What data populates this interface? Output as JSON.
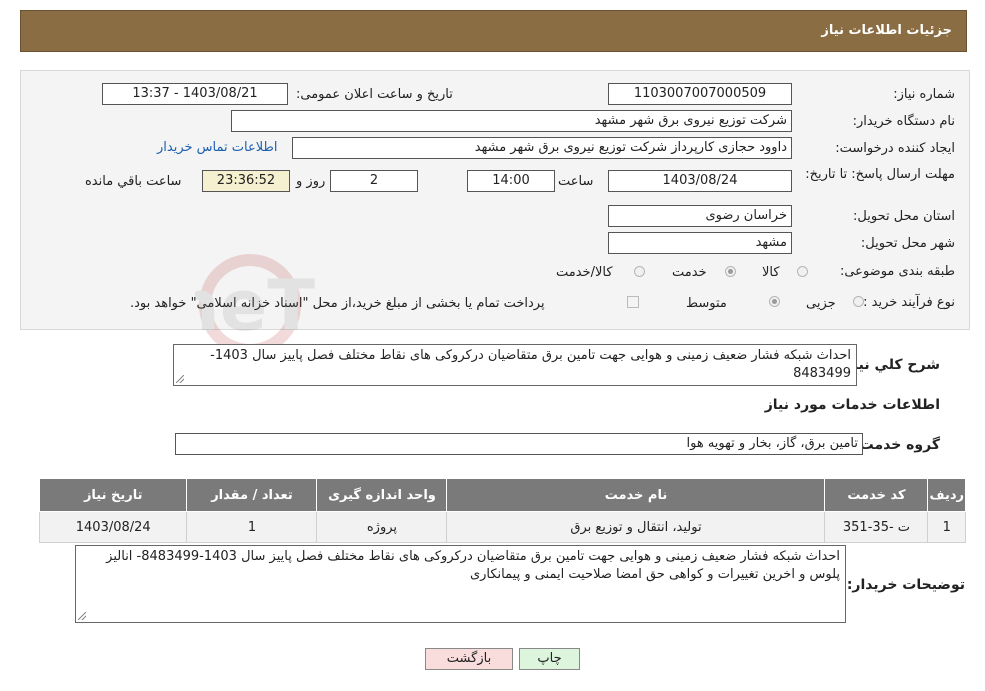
{
  "header": {
    "title": "جزئیات اطلاعات نیاز"
  },
  "form": {
    "need_number": {
      "label": "شماره نیاز:",
      "value": "1103007007000509"
    },
    "announce_datetime": {
      "label": "تاریخ و ساعت اعلان عمومی:",
      "value": "1403/08/21 - 13:37"
    },
    "buyer_org": {
      "label": "نام دستگاه خريدار:",
      "value": "شرکت توزیع نیروی برق شهر مشهد"
    },
    "requester": {
      "label": "ایجاد کننده درخواست:",
      "value": "داوود حجازی کارپرداز شرکت توزیع نیروی برق شهر مشهد",
      "contact_link": "اطلاعات تماس خریدار"
    },
    "deadline": {
      "label": "مهلت ارسال پاسخ: تا تاریخ:",
      "date": "1403/08/24",
      "time_label": "ساعت",
      "time": "14:00",
      "days": "2",
      "days_label": "روز و",
      "remaining": "23:36:52",
      "remaining_label": "ساعت باقي مانده"
    },
    "province": {
      "label": "استان محل تحویل:",
      "value": "خراسان رضوی"
    },
    "city": {
      "label": "شهر محل تحویل:",
      "value": "مشهد"
    },
    "category": {
      "label": "طبقه بندی موضوعی:",
      "options": [
        {
          "label": "کالا",
          "checked": false
        },
        {
          "label": "خدمت",
          "checked": true
        },
        {
          "label": "کالا/خدمت",
          "checked": false
        }
      ]
    },
    "purchase_type": {
      "label": "نوع فرآیند خرید :",
      "options": [
        {
          "label": "جزیی",
          "checked": false
        },
        {
          "label": "متوسط",
          "checked": true
        }
      ],
      "treasury_checkbox_label": "پرداخت تمام یا بخشی از مبلغ خرید،از محل \"اسناد خزانه اسلامی\" خواهد بود."
    }
  },
  "description": {
    "label": "شرح کلي نياز:",
    "value": "احداث شبکه فشار ضعیف زمینی و هوایی جهت تامین برق متقاضیان درکروکی های نقاط مختلف فصل پاییز سال 1403-8483499"
  },
  "services_section": {
    "title": "اطلاعات خدمات مورد نياز"
  },
  "service_group": {
    "label": "گروه خدمت:",
    "value": "تامین برق، گاز، بخار و تهویه هوا"
  },
  "table": {
    "headers": [
      "ردیف",
      "کد خدمت",
      "نام خدمت",
      "واحد اندازه گیری",
      "تعداد / مقدار",
      "تاریخ نیاز"
    ],
    "rows": [
      [
        "1",
        "ت -35-351",
        "تولید، انتقال و توزیع برق",
        "پروژه",
        "1",
        "1403/08/24"
      ]
    ]
  },
  "buyer_notes": {
    "label": "توضیحات خریدار:",
    "value": "احداث شبکه فشار ضعیف زمینی و هوایی جهت تامین برق متقاضیان درکروکی های نقاط مختلف فصل پاییز سال 1403-8483499-  انالیز  پلوس  و اخرین تغییرات و کواهی حق امضا صلاحیت ایمنی و پیمانکاری"
  },
  "buttons": {
    "print": "چاپ",
    "back": "بازگشت"
  },
  "watermark": {
    "text": "AriaTender.neT"
  }
}
